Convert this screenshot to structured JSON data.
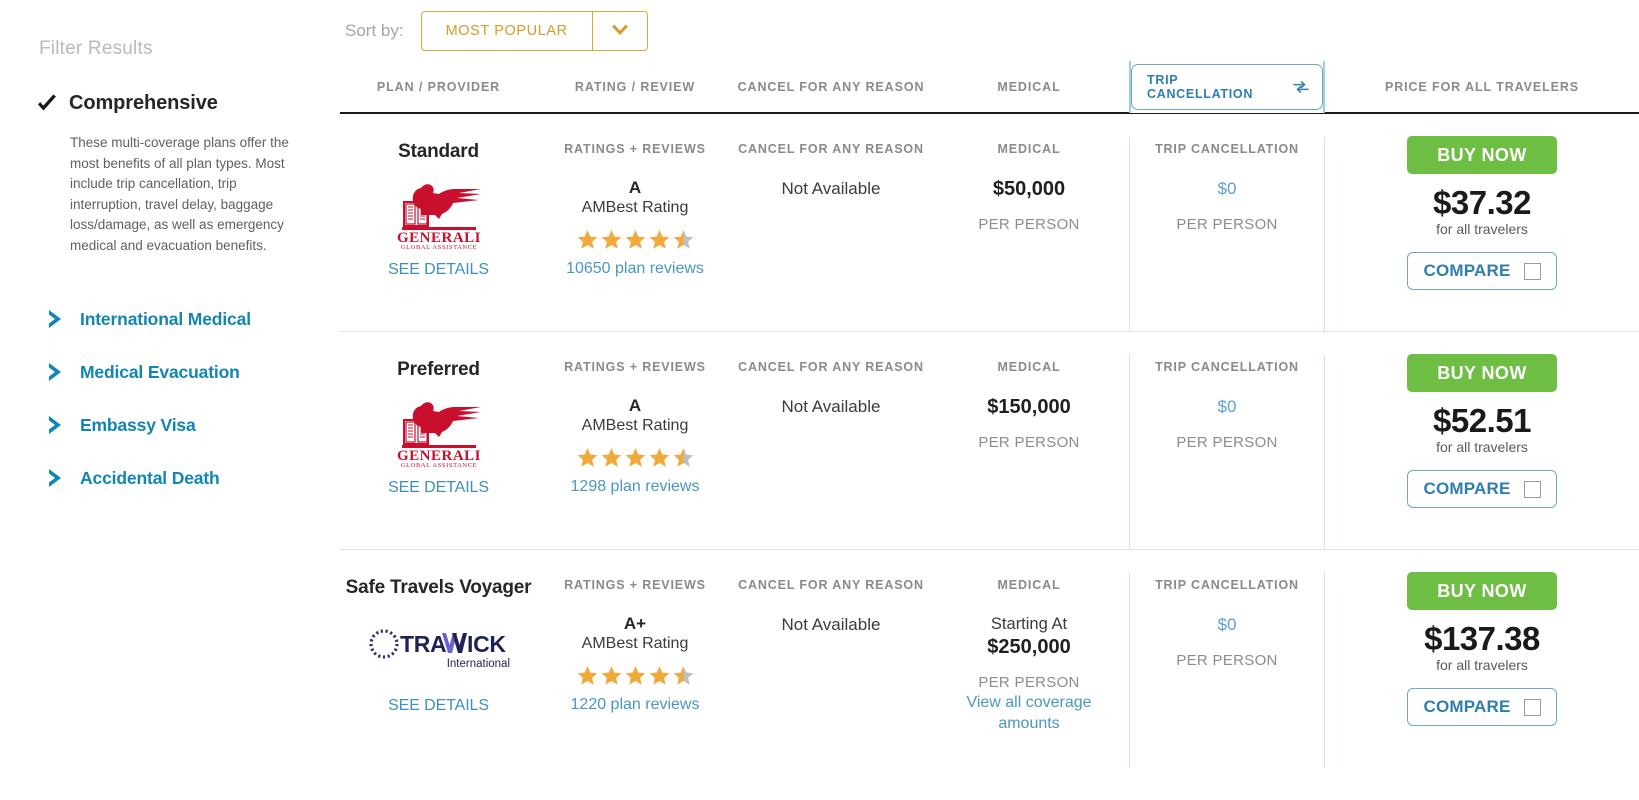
{
  "sidebar": {
    "title": "Filter Results",
    "active_filter": {
      "label": "Comprehensive",
      "icon": "check-icon",
      "description": "These multi-coverage plans offer the most benefits of all plan types. Most include trip cancellation, trip interruption, travel delay, baggage loss/damage, as well as emergency medical and evacuation benefits."
    },
    "items": [
      {
        "label": "International Medical",
        "icon": "chevron-right-icon"
      },
      {
        "label": "Medical Evacuation",
        "icon": "chevron-right-icon"
      },
      {
        "label": "Embassy Visa",
        "icon": "chevron-right-icon"
      },
      {
        "label": "Accidental Death",
        "icon": "chevron-right-icon"
      }
    ]
  },
  "sort": {
    "label": "Sort by:",
    "value": "MOST POPULAR",
    "caret_icon": "chevron-down-icon"
  },
  "table": {
    "headers": {
      "plan": "PLAN / PROVIDER",
      "rating": "RATING / REVIEW",
      "cfar": "CANCEL FOR ANY REASON",
      "medical": "MEDICAL",
      "trip": "TRIP CANCELLATION",
      "trip_icon": "swap-horizontal-icon",
      "price": "PRICE FOR ALL TRAVELERS"
    },
    "rows": [
      {
        "plan_name": "Standard",
        "provider_logo": "generali-global-assistance-logo",
        "provider_name": "GENERALI",
        "provider_tagline": "GLOBAL ASSISTANCE",
        "see_details": "SEE DETAILS",
        "rating_label": "RATINGS + REVIEWS",
        "grade": "A",
        "grade_sub": "AMBest Rating",
        "stars": 4.5,
        "reviews": "10650 plan reviews",
        "cfar_label": "CANCEL FOR ANY REASON",
        "cfar_value": "Not Available",
        "medical_label": "MEDICAL",
        "medical_prefix": "",
        "medical_value": "$50,000",
        "medical_per": "PER PERSON",
        "medical_link": "",
        "trip_label": "TRIP CANCELLATION",
        "trip_value": "$0",
        "trip_per": "PER PERSON",
        "buy_label": "BUY NOW",
        "price": "$37.32",
        "price_sub": "for all travelers",
        "compare_label": "COMPARE",
        "compare_checked": false
      },
      {
        "plan_name": "Preferred",
        "provider_logo": "generali-global-assistance-logo",
        "provider_name": "GENERALI",
        "provider_tagline": "GLOBAL ASSISTANCE",
        "see_details": "SEE DETAILS",
        "rating_label": "RATINGS + REVIEWS",
        "grade": "A",
        "grade_sub": "AMBest Rating",
        "stars": 4.5,
        "reviews": "1298 plan reviews",
        "cfar_label": "CANCEL FOR ANY REASON",
        "cfar_value": "Not Available",
        "medical_label": "MEDICAL",
        "medical_prefix": "",
        "medical_value": "$150,000",
        "medical_per": "PER PERSON",
        "medical_link": "",
        "trip_label": "TRIP CANCELLATION",
        "trip_value": "$0",
        "trip_per": "PER PERSON",
        "buy_label": "BUY NOW",
        "price": "$52.51",
        "price_sub": "for all travelers",
        "compare_label": "COMPARE",
        "compare_checked": false
      },
      {
        "plan_name": "Safe Travels Voyager",
        "provider_logo": "trawick-international-logo",
        "provider_name": "TRAWICK",
        "provider_tagline": "International",
        "see_details": "SEE DETAILS",
        "rating_label": "RATINGS + REVIEWS",
        "grade": "A+",
        "grade_sub": "AMBest Rating",
        "stars": 4.5,
        "reviews": "1220 plan reviews",
        "cfar_label": "CANCEL FOR ANY REASON",
        "cfar_value": "Not Available",
        "medical_label": "MEDICAL",
        "medical_prefix": "Starting At",
        "medical_value": "$250,000",
        "medical_per": "PER PERSON",
        "medical_link": "View all coverage amounts",
        "trip_label": "TRIP CANCELLATION",
        "trip_value": "$0",
        "trip_per": "PER PERSON",
        "buy_label": "BUY NOW",
        "price": "$137.38",
        "price_sub": "for all travelers",
        "compare_label": "COMPARE",
        "compare_checked": false
      }
    ]
  },
  "colors": {
    "accent_blue": "#1186b4",
    "link_blue": "#4a96c3",
    "buy_green": "#6ebe43",
    "sort_gold": "#d79b29",
    "star_gold": "#f2a93b",
    "star_grey": "#bfbfbf",
    "generali_red": "#c8102e",
    "trawick_navy": "#1f2255"
  }
}
